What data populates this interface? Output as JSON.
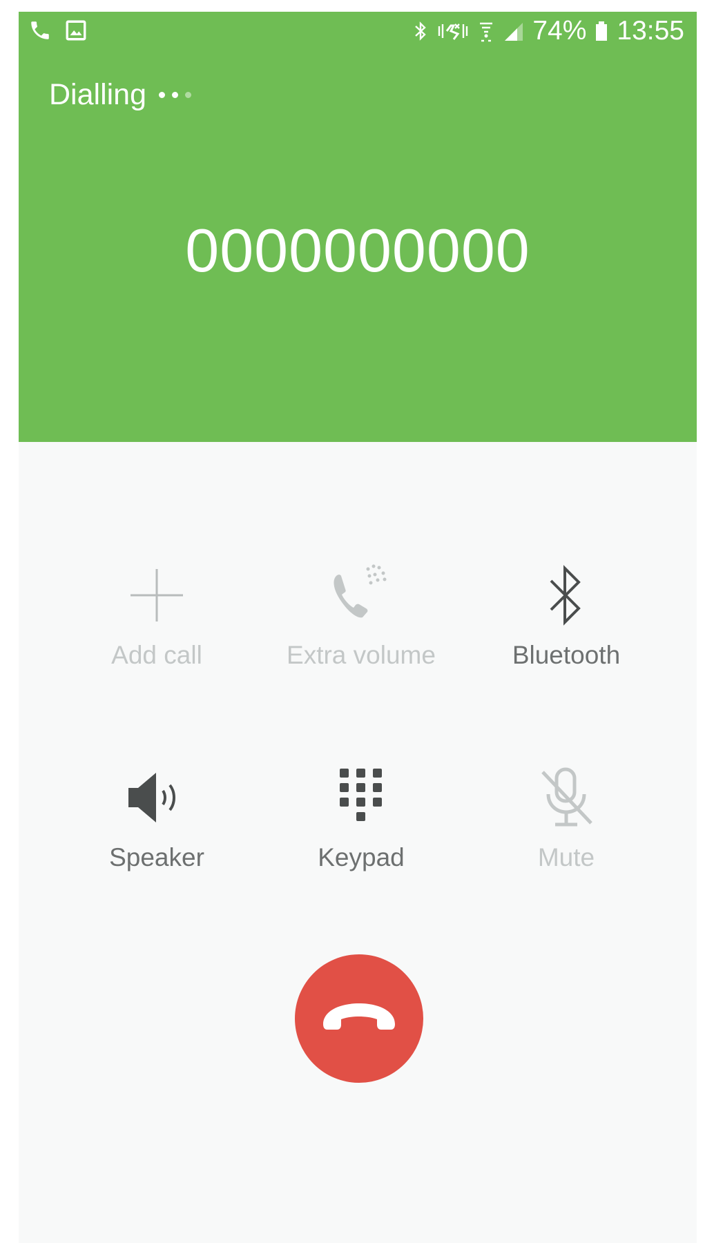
{
  "status_bar": {
    "battery_percent": "74%",
    "time": "13:55",
    "icons": [
      "phone-icon",
      "gallery-icon",
      "bluetooth-icon",
      "vibrate-icon",
      "wifi-icon",
      "signal-icon",
      "battery-icon"
    ]
  },
  "call": {
    "status": "Dialling",
    "number": "0000000000"
  },
  "controls": {
    "add_call": {
      "label": "Add call",
      "icon": "add-icon",
      "enabled": false
    },
    "extra_volume": {
      "label": "Extra volume",
      "icon": "extra-volume-icon",
      "enabled": false
    },
    "bluetooth": {
      "label": "Bluetooth",
      "icon": "bluetooth-icon",
      "enabled": true
    },
    "speaker": {
      "label": "Speaker",
      "icon": "speaker-icon",
      "enabled": true
    },
    "keypad": {
      "label": "Keypad",
      "icon": "keypad-icon",
      "enabled": true
    },
    "mute": {
      "label": "Mute",
      "icon": "mute-icon",
      "enabled": false
    }
  },
  "end_call": {
    "icon": "end-call-icon",
    "color": "#e15046"
  },
  "colors": {
    "header_green": "#6fbd54",
    "background": "#f8f9f9",
    "disabled_text": "#c3c7c7",
    "enabled_text": "#6d7070"
  }
}
